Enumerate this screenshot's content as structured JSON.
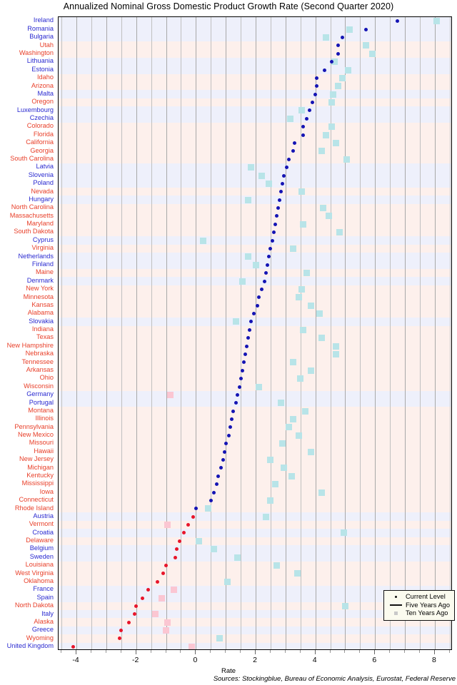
{
  "chart_data": {
    "type": "scatter",
    "title": "Annualized Nominal Gross Domestic Product Growth Rate (Second Quarter 2020)",
    "xlabel": "Rate",
    "ylabel": "",
    "xlim": [
      -4.6,
      8.6
    ],
    "xticks": [
      -4,
      -2,
      0,
      2,
      4,
      6,
      8
    ],
    "xticklabels": [
      "-4",
      "-2",
      "0",
      "2",
      "4",
      "6",
      "8"
    ],
    "grid": true,
    "legend_position": "bottom-right",
    "legend": [
      {
        "label": "Current Level",
        "marker": "dot"
      },
      {
        "label": "Five Years Ago",
        "marker": "line"
      },
      {
        "label": "Ten Years Ago",
        "marker": "square"
      }
    ],
    "sources": "Sources: Stockingblue, Bureau of Economic Analysis, Eurostat, Federal Reserve",
    "colors": {
      "positive_point": "#1414b4",
      "negative_point": "#e8152a",
      "positive_square": "#b8e4e8",
      "negative_square": "#fbc6d2",
      "eu_band": "#eef0fb",
      "us_band": "#fdf0ec",
      "eu_label": "#2a2ad0",
      "us_label": "#e8402a",
      "legend_background": "#fbfbef"
    },
    "categories": [
      "Ireland",
      "Romania",
      "Bulgaria",
      "Utah",
      "Washington",
      "Lithuania",
      "Estonia",
      "Idaho",
      "Arizona",
      "Malta",
      "Oregon",
      "Luxembourg",
      "Czechia",
      "Colorado",
      "Florida",
      "California",
      "Georgia",
      "South Carolina",
      "Latvia",
      "Slovenia",
      "Poland",
      "Nevada",
      "Hungary",
      "North Carolina",
      "Massachusetts",
      "Maryland",
      "South Dakota",
      "Cyprus",
      "Virginia",
      "Netherlands",
      "Finland",
      "Maine",
      "Denmark",
      "New York",
      "Minnesota",
      "Kansas",
      "Alabama",
      "Slovakia",
      "Indiana",
      "Texas",
      "New Hampshire",
      "Nebraska",
      "Tennessee",
      "Arkansas",
      "Ohio",
      "Wisconsin",
      "Germany",
      "Portugal",
      "Montana",
      "Illinois",
      "Pennsylvania",
      "New Mexico",
      "Missouri",
      "Hawaii",
      "New Jersey",
      "Michigan",
      "Kentucky",
      "Mississippi",
      "Iowa",
      "Connecticut",
      "Rhode Island",
      "Austria",
      "Vermont",
      "Croatia",
      "Delaware",
      "Belgium",
      "Sweden",
      "Louisiana",
      "West Virginia",
      "Oklahoma",
      "France",
      "Spain",
      "North Dakota",
      "Italy",
      "Alaska",
      "Greece",
      "Wyoming",
      "United Kingdom"
    ],
    "region": [
      "eu",
      "eu",
      "eu",
      "us",
      "us",
      "eu",
      "eu",
      "us",
      "us",
      "eu",
      "us",
      "eu",
      "eu",
      "us",
      "us",
      "us",
      "us",
      "us",
      "eu",
      "eu",
      "eu",
      "us",
      "eu",
      "us",
      "us",
      "us",
      "us",
      "eu",
      "us",
      "eu",
      "eu",
      "us",
      "eu",
      "us",
      "us",
      "us",
      "us",
      "eu",
      "us",
      "us",
      "us",
      "us",
      "us",
      "us",
      "us",
      "us",
      "eu",
      "eu",
      "us",
      "us",
      "us",
      "us",
      "us",
      "us",
      "us",
      "us",
      "us",
      "us",
      "us",
      "us",
      "us",
      "eu",
      "us",
      "eu",
      "us",
      "eu",
      "eu",
      "us",
      "us",
      "us",
      "eu",
      "eu",
      "us",
      "eu",
      "us",
      "eu",
      "us",
      "eu"
    ],
    "series": [
      {
        "name": "Current Level",
        "marker": "dot",
        "values": [
          6.75,
          5.7,
          4.9,
          4.75,
          4.75,
          4.55,
          4.3,
          4.05,
          4.05,
          4.0,
          3.9,
          3.8,
          3.7,
          3.6,
          3.6,
          3.3,
          3.25,
          3.1,
          3.05,
          2.95,
          2.9,
          2.85,
          2.8,
          2.75,
          2.7,
          2.65,
          2.6,
          2.55,
          2.5,
          2.45,
          2.4,
          2.35,
          2.3,
          2.2,
          2.1,
          2.05,
          1.95,
          1.85,
          1.8,
          1.75,
          1.7,
          1.65,
          1.6,
          1.55,
          1.5,
          1.45,
          1.4,
          1.35,
          1.25,
          1.2,
          1.15,
          1.1,
          1.0,
          0.95,
          0.9,
          0.85,
          0.75,
          0.7,
          0.6,
          0.5,
          0.0,
          -0.1,
          -0.25,
          -0.4,
          -0.55,
          -0.65,
          -0.7,
          -1.0,
          -1.1,
          -1.3,
          -1.6,
          -1.8,
          -2.0,
          -2.05,
          -2.25,
          -2.5,
          -2.55,
          -4.1
        ]
      },
      {
        "name": "Ten Years Ago",
        "marker": "square",
        "values": [
          8.05,
          5.15,
          4.35,
          5.7,
          5.9,
          4.65,
          5.1,
          4.9,
          4.75,
          4.6,
          4.55,
          3.55,
          3.15,
          4.55,
          4.35,
          4.7,
          4.2,
          5.05,
          1.85,
          2.2,
          2.45,
          3.55,
          1.75,
          4.25,
          4.45,
          3.6,
          4.8,
          0.25,
          3.25,
          1.75,
          2.0,
          3.7,
          1.55,
          3.55,
          3.45,
          3.85,
          4.15,
          1.35,
          3.6,
          4.2,
          4.7,
          4.7,
          3.25,
          3.85,
          3.5,
          2.1,
          -0.85,
          2.85,
          3.65,
          3.25,
          3.1,
          3.45,
          2.9,
          3.85,
          2.5,
          2.95,
          3.2,
          2.65,
          4.2,
          2.5,
          0.4,
          2.35,
          -0.95,
          4.95,
          0.1,
          0.6,
          1.4,
          2.7,
          3.4,
          1.05,
          -0.75,
          -1.15,
          5.0,
          -1.35,
          -0.95,
          -1.0,
          0.8,
          -0.15
        ]
      }
    ],
    "notes": "Each row shows a country or U.S. state; blue/red dots are the current level, pale squares are the level ten years ago."
  }
}
